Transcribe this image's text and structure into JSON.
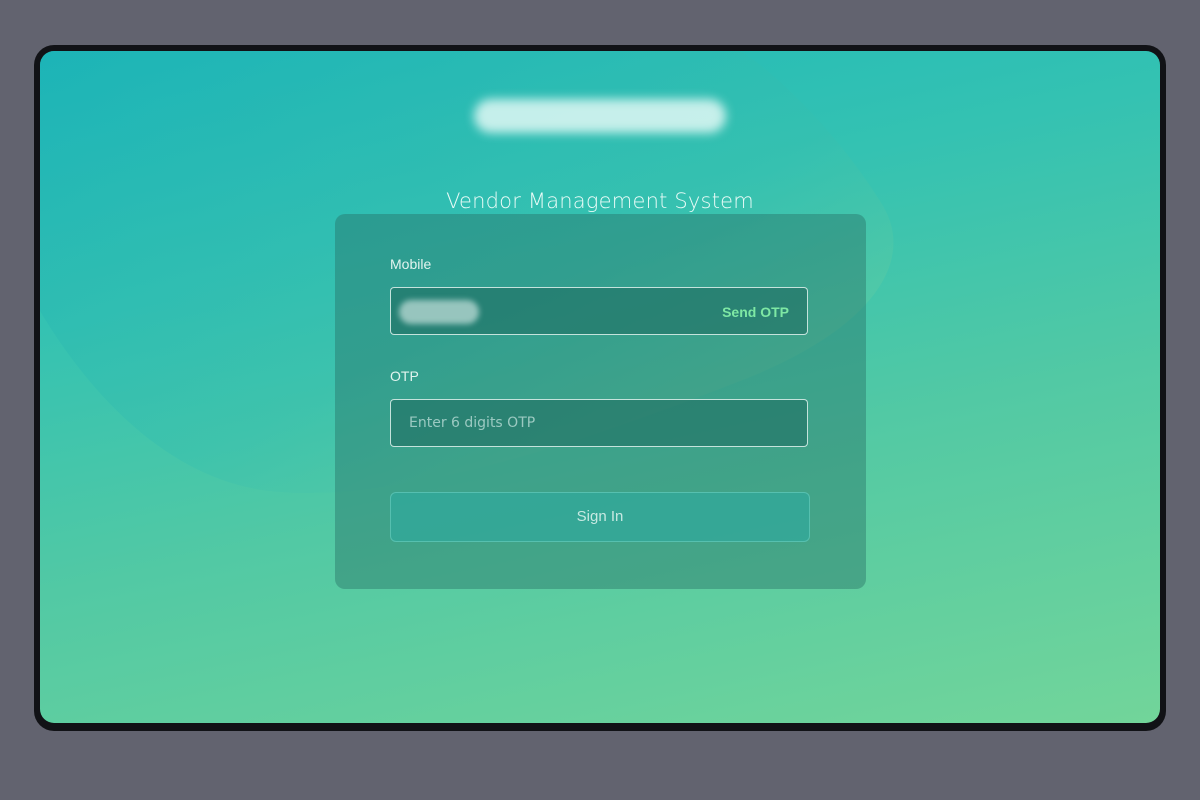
{
  "header": {
    "subtitle": "Vendor Management System"
  },
  "login": {
    "mobile_label": "Mobile",
    "send_otp_label": "Send OTP",
    "otp_label": "OTP",
    "otp_placeholder": "Enter 6 digits OTP",
    "otp_value": "",
    "sign_in_label": "Sign In"
  },
  "colors": {
    "page_background": "#62636f",
    "gradient_top": "#1fb9b9",
    "gradient_bottom": "#72d59a",
    "send_otp_accent": "#7ee8a4"
  }
}
